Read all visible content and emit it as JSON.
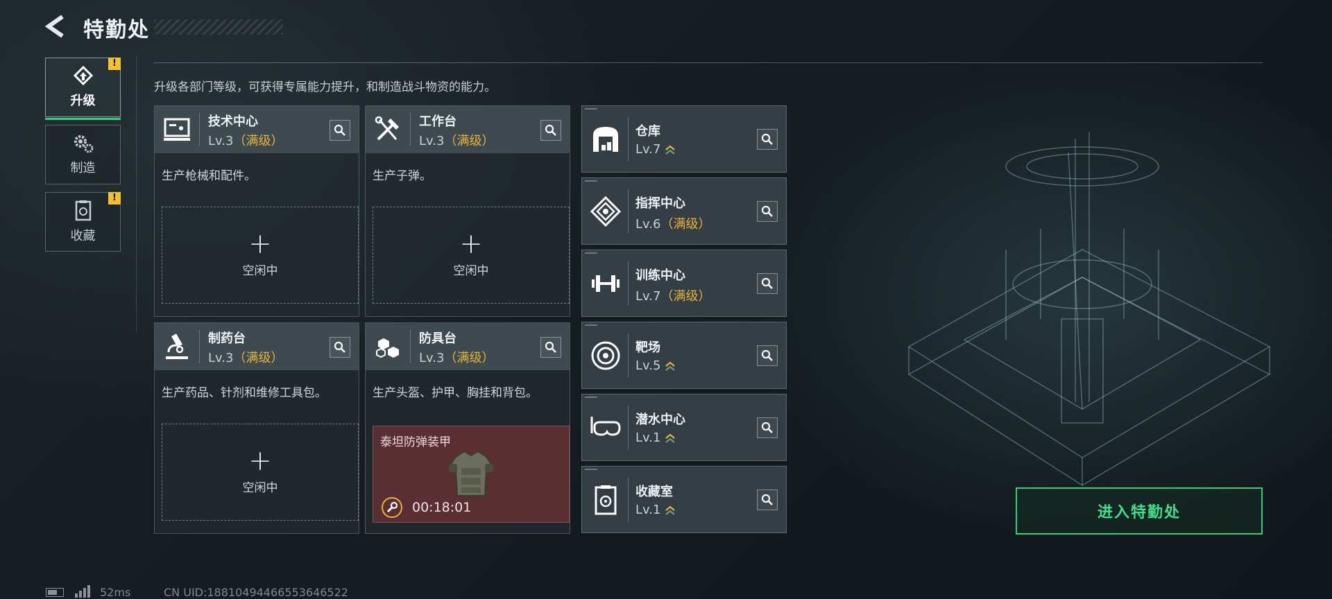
{
  "header": {
    "title": "特勤处",
    "back_icon": "back-arrow-icon"
  },
  "subtitle": "升级各部门等级，可获得专属能力提升，和制造战斗物资的能力。",
  "tabs": [
    {
      "label": "升级",
      "icon": "upgrade-icon",
      "active": true,
      "warning": "!"
    },
    {
      "label": "制造",
      "icon": "gears-icon",
      "active": false,
      "warning": ""
    },
    {
      "label": "收藏",
      "icon": "collection-icon",
      "active": false,
      "warning": "!"
    }
  ],
  "cards": [
    {
      "name": "技术中心",
      "level": "Lv.3",
      "status": "（满级）",
      "icon": "monitor-icon",
      "desc": "生产枪械和配件。",
      "slot_state": "空闲中",
      "plus": "+"
    },
    {
      "name": "工作台",
      "level": "Lv.3",
      "status": "（满级）",
      "icon": "tools-icon",
      "desc": "生产子弹。",
      "slot_state": "空闲中",
      "plus": "+"
    },
    {
      "name": "制药台",
      "level": "Lv.3",
      "status": "（满级）",
      "icon": "microscope-icon",
      "desc": "生产药品、针剂和维修工具包。",
      "slot_state": "空闲中",
      "plus": "+"
    },
    {
      "name": "防具台",
      "level": "Lv.3",
      "status": "（满级）",
      "icon": "armor-blocks-icon",
      "desc": "生产头盔、护甲、胸挂和背包。",
      "job_name": "泰坦防弹装甲",
      "job_time": "00:18:01"
    }
  ],
  "facilities": [
    {
      "name": "仓库",
      "level": "Lv.7",
      "status": "",
      "upgradable": true,
      "icon": "warehouse-icon"
    },
    {
      "name": "指挥中心",
      "level": "Lv.6",
      "status": "（满级）",
      "upgradable": false,
      "icon": "command-icon"
    },
    {
      "name": "训练中心",
      "level": "Lv.7",
      "status": "（满级）",
      "upgradable": false,
      "icon": "dumbbell-icon"
    },
    {
      "name": "靶场",
      "level": "Lv.5",
      "status": "",
      "upgradable": true,
      "icon": "target-icon"
    },
    {
      "name": "潜水中心",
      "level": "Lv.1",
      "status": "",
      "upgradable": true,
      "icon": "dive-mask-icon"
    },
    {
      "name": "收藏室",
      "level": "Lv.1",
      "status": "",
      "upgradable": true,
      "icon": "vault-icon"
    }
  ],
  "enter_button": "进入特勤处",
  "footer": {
    "ping": "52ms",
    "uid": "CN UID:18810494466553646522"
  },
  "colors": {
    "accent_green": "#2bd17c",
    "maxed_gold": "#e7b43a",
    "warning_yellow": "#f2c230",
    "job_bg": "#5a2f34"
  }
}
